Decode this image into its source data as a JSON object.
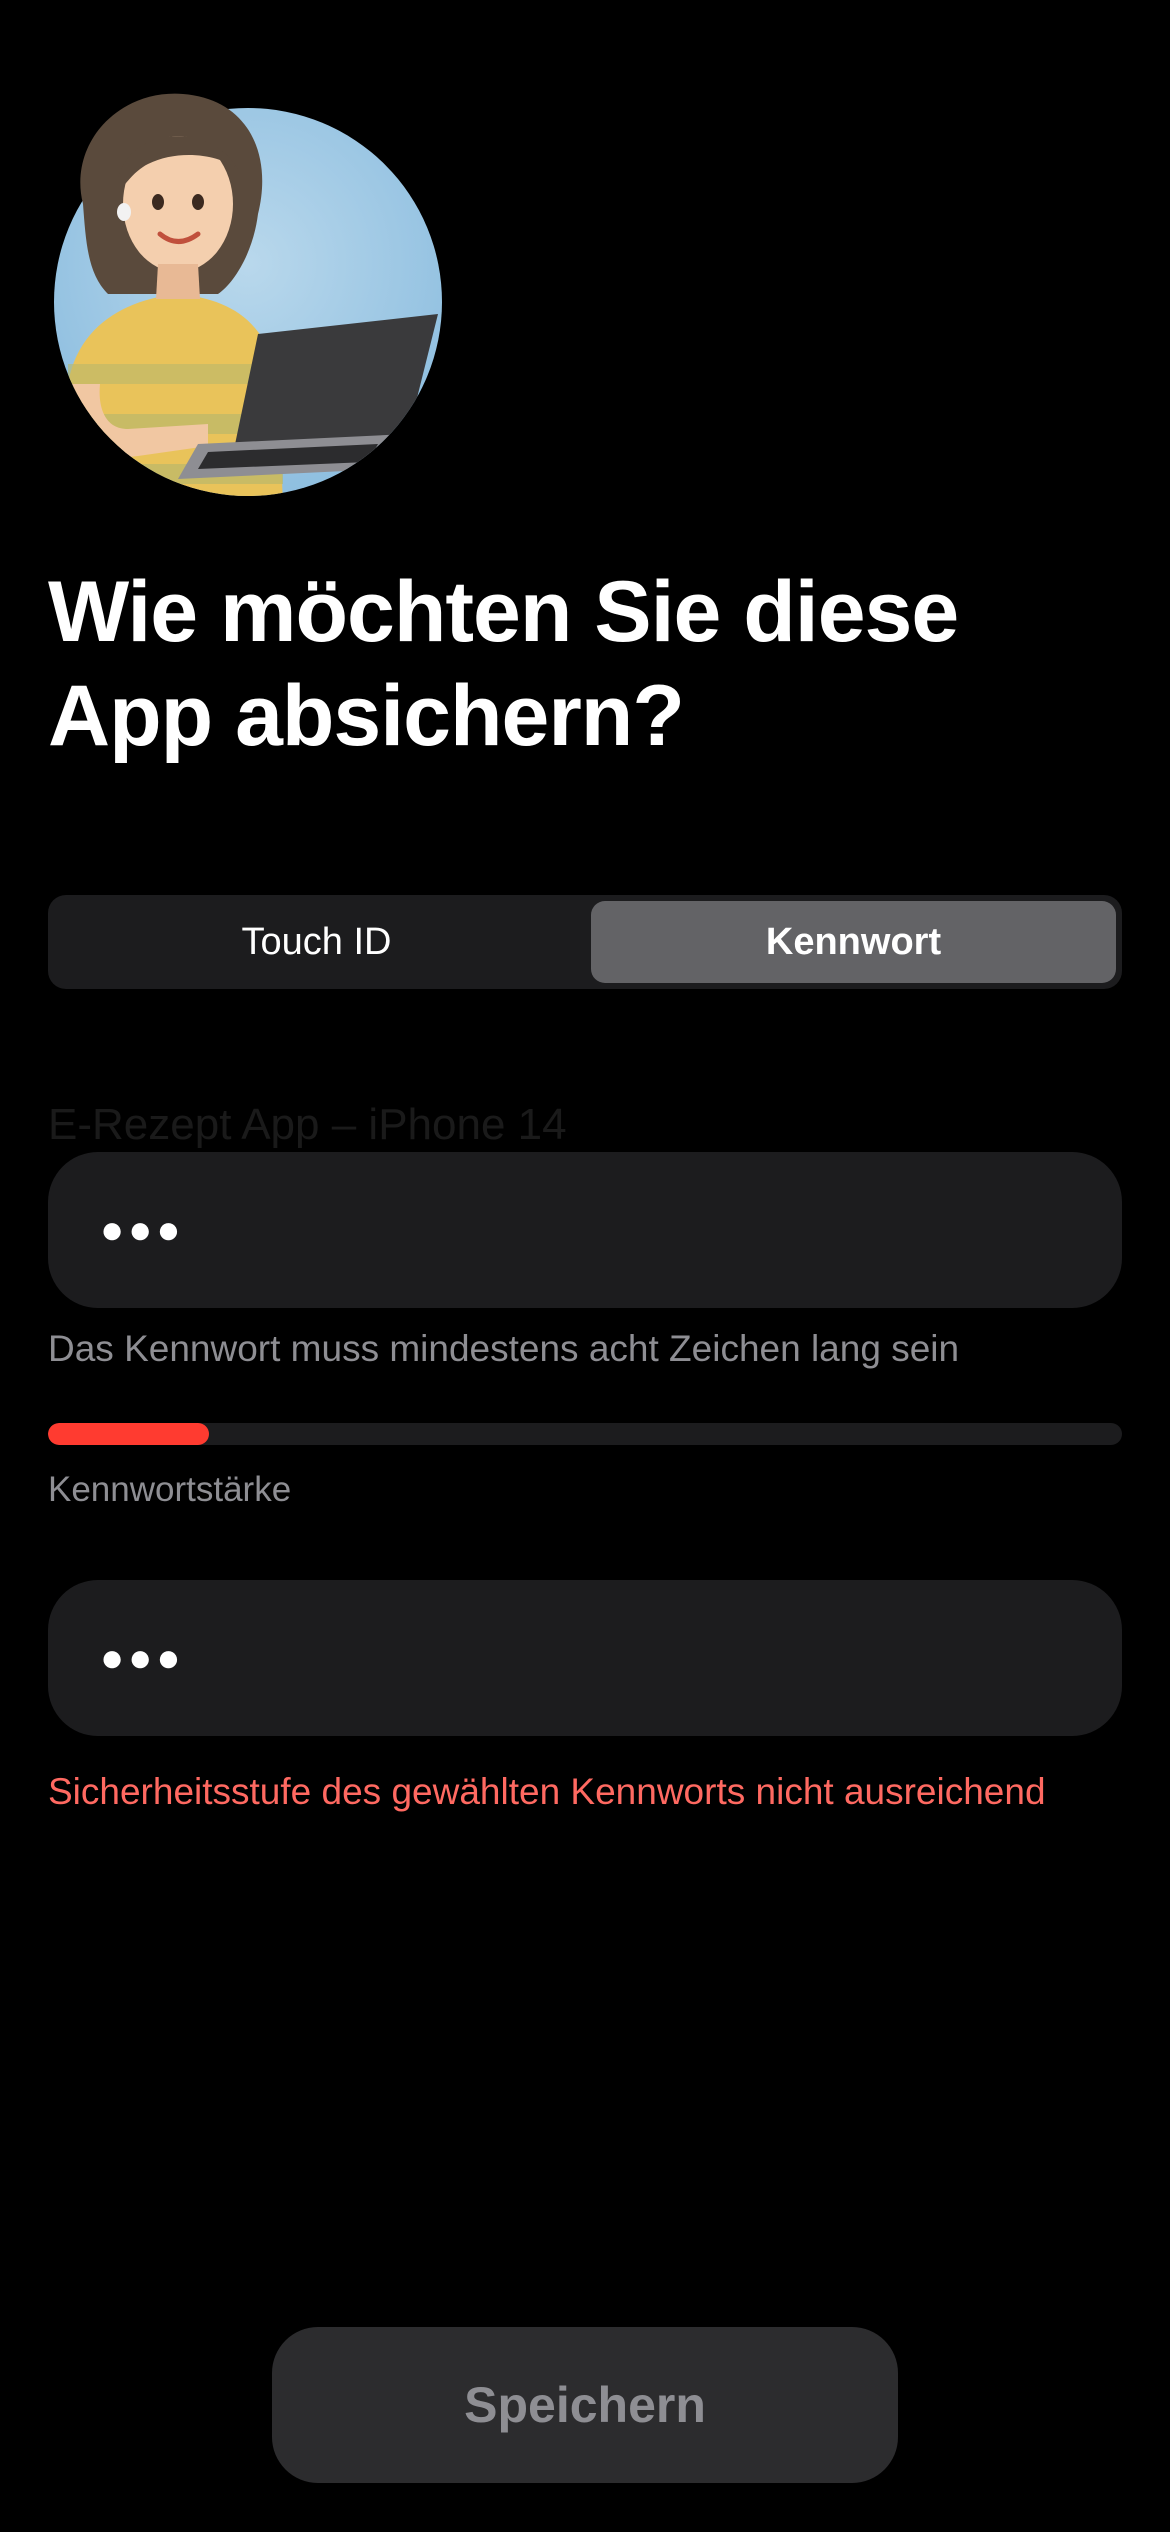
{
  "header": {
    "title_line1": "Wie möchten Sie diese",
    "title_line2": "App absichern?"
  },
  "segmented_control": {
    "options": [
      {
        "label": "Touch ID",
        "selected": false
      },
      {
        "label": "Kennwort",
        "selected": true
      }
    ]
  },
  "background_label": "E-Rezept App – iPhone 14",
  "password_field": {
    "value": "●●●"
  },
  "password_hint": "Das Kennwort muss mindestens acht Zeichen lang sein",
  "strength": {
    "label": "Kennwortstärke",
    "level_fraction": 0.15,
    "color": "#ff3b30"
  },
  "confirm_field": {
    "value": "●●●"
  },
  "error_message": "Sicherheitsstufe des gewählten Kennworts nicht ausreichend",
  "save_button": {
    "label": "Speichern",
    "enabled": false
  },
  "colors": {
    "background": "#000000",
    "field": "#1c1c1e",
    "active_segment": "#636366",
    "error": "#ff6961",
    "secondary_text": "#8e8e93"
  }
}
